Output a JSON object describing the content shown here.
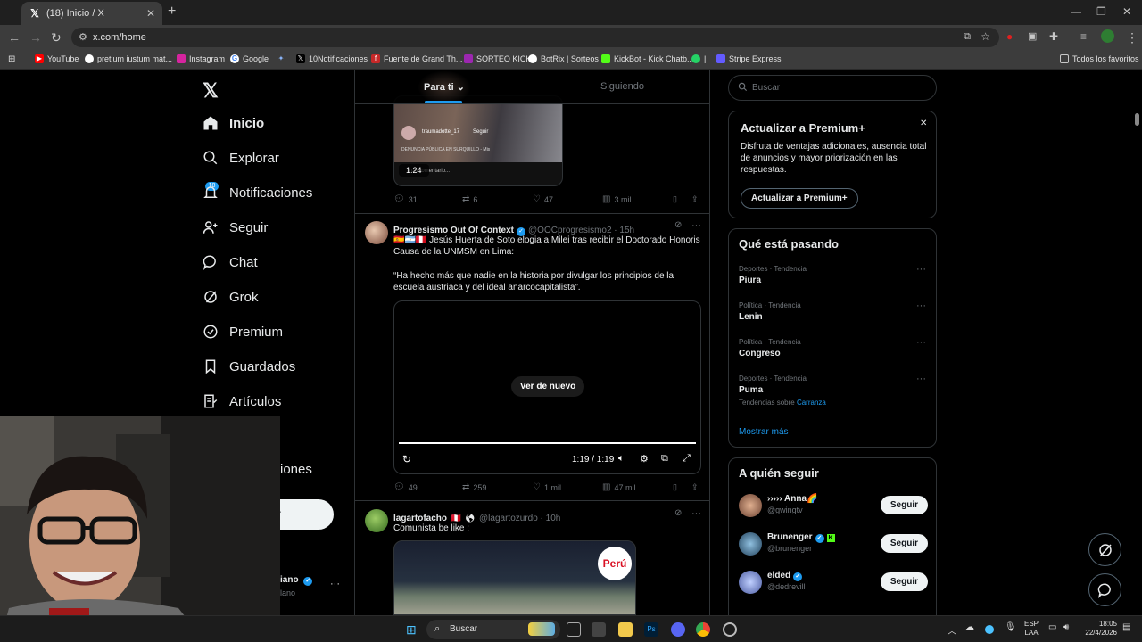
{
  "browser": {
    "tab_title": "(18) Inicio / X",
    "url": "x.com/home",
    "bookmarks": [
      "YouTube",
      "pretium iustum mat...",
      "Instagram",
      "Google",
      "10Notificaciones",
      "Fuente de Grand Th...",
      "SORTEO KICK",
      "BotRix | Sorteos",
      "KickBot - Kick Chatb...",
      "|",
      "Stripe Express"
    ],
    "all_bookmarks": "Todos los favoritos"
  },
  "nav": {
    "badge": "18",
    "items": [
      "Inicio",
      "Explorar",
      "Notificaciones",
      "Seguir",
      "Chat",
      "Grok",
      "Premium",
      "Guardados",
      "Artículos"
    ],
    "partial_more": "iones",
    "partial_post": "r",
    "partial_profile_name": "iano",
    "partial_profile_handle": "lano",
    "profile_more": "···"
  },
  "feed": {
    "tabs": [
      "Para ti",
      "Siguiendo"
    ],
    "video1": {
      "time": "1:24",
      "comment_placeholder": "a un comentario...",
      "user": "traumadotte_17",
      "follow": "Seguir",
      "caption": "DENUNCIA PÚBLICA EN SURQUILLO - Mis"
    },
    "post0_actions": {
      "replies": "31",
      "reposts": "6",
      "likes": "47",
      "views": "3 mil"
    },
    "post1": {
      "name": "Progresismo Out Of Context",
      "handle": "@OOCprogresismo2 · 15h",
      "text1": "🇪🇸🇦🇷🇵🇪 Jesús Huerta de Soto elogia a Milei tras recibir el Doctorado Honoris Causa de la UNMSM en Lima:",
      "text2": "“Ha hecho más que nadie en la historia por divulgar los principios de la escuela austriaca y del ideal anarcocapitalista”.",
      "replay": "Ver de nuevo",
      "time": "1:19 / 1:19",
      "actions": {
        "replies": "49",
        "reposts": "259",
        "likes": "1 mil",
        "views": "47 mil"
      }
    },
    "post2": {
      "name": "lagartofacho",
      "flag": "🇵🇪",
      "handle": "@lagartozurdo · 10h",
      "text": "Comunista be like :",
      "logo": "Perú"
    }
  },
  "right": {
    "search_placeholder": "Buscar",
    "premium": {
      "title": "Actualizar a Premium+",
      "body": "Disfruta de ventajas adicionales, ausencia total de anuncios y mayor priorización en las respuestas.",
      "button": "Actualizar a Premium+"
    },
    "trends": {
      "title": "Qué está pasando",
      "items": [
        {
          "meta": "Deportes · Tendencia",
          "name": "Piura"
        },
        {
          "meta": "Política · Tendencia",
          "name": "Lenin"
        },
        {
          "meta": "Política · Tendencia",
          "name": "Congreso"
        },
        {
          "meta": "Deportes · Tendencia",
          "name": "Puma"
        }
      ],
      "related_prefix": "Tendencias sobre",
      "related_link": "Carranza",
      "more": "Mostrar más"
    },
    "who": {
      "title": "A quién seguir",
      "follow": "Seguir",
      "users": [
        {
          "name": "››››› Anna🌈",
          "handle": "@gwingtv"
        },
        {
          "name": "Brunenger",
          "handle": "@brunenger"
        },
        {
          "name": "elded",
          "handle": "@dedrevill"
        }
      ]
    }
  },
  "taskbar": {
    "search": "Buscar",
    "lang1": "ESP",
    "lang2": "LAA",
    "time": "18:05",
    "date": "22/4/2026"
  }
}
